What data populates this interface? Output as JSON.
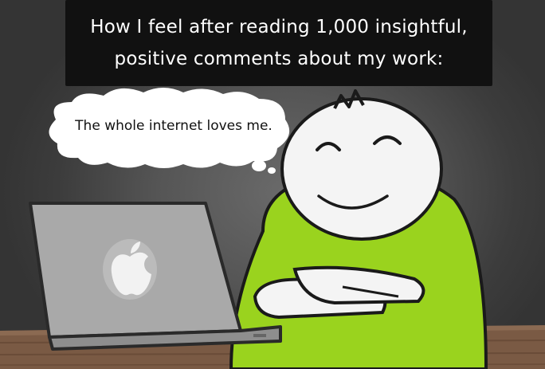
{
  "caption": {
    "line1": "How I feel after reading 1,000 insightful,",
    "line2": "positive comments about my work:"
  },
  "thought_bubble": {
    "text": "The whole internet loves me."
  },
  "colors": {
    "caption_background": "#111111",
    "caption_text": "#ffffff",
    "shirt": "#9ad31e",
    "skin": "#f4f4f4",
    "laptop": "#a9a9a9",
    "table": "#7a5a44",
    "wall": "#444444"
  },
  "icons": {
    "laptop_logo": "apple-logo-icon"
  }
}
